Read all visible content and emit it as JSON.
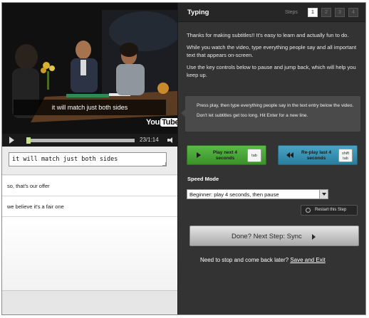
{
  "video": {
    "subtitle_overlay": "it will match just both sides",
    "logo_text": "You",
    "logo_tube": "Tube",
    "time_readout": "23/1:14",
    "progress_fraction": 0.02
  },
  "editor": {
    "input_value": "it will match just both sides",
    "subtitle_lines": [
      "so, that's our offer",
      "we believe it's a fair one"
    ]
  },
  "panel": {
    "title": "Typing",
    "steps_label": "Steps",
    "steps": [
      "1",
      "2",
      "3",
      "4"
    ],
    "active_step": 1,
    "intro": [
      "Thanks for making subtitles!! It's easy to learn and actually fun to do.",
      "While you watch the video, type everything people say and all important text that appears on-screen.",
      "Use the key controls below to pause and jump back, which will help you keep up."
    ],
    "hint": {
      "main": "Press play, then type everything people say in the text entry below the video.",
      "tip": "Don't let subtitles get too long. Hit Enter for a new line."
    },
    "play_button": {
      "line1": "Play next 4",
      "line2": "seconds",
      "key": "tab"
    },
    "replay_button": {
      "line1": "Re-play last 4",
      "line2": "seconds",
      "key_line1": "shift",
      "key_line2": "tab"
    },
    "speed_mode_label": "Speed Mode",
    "speed_mode_value": "Beginner: play 4 seconds, then pause",
    "restart_label": "Restart this Step",
    "next_step_label": "Done? Next Step: Sync",
    "save_prompt": "Need to stop and come back later?",
    "save_link": "Save and Exit"
  },
  "colors": {
    "play_green": "#4aa63a",
    "replay_blue": "#3a90b3",
    "panel_bg": "#333333"
  }
}
